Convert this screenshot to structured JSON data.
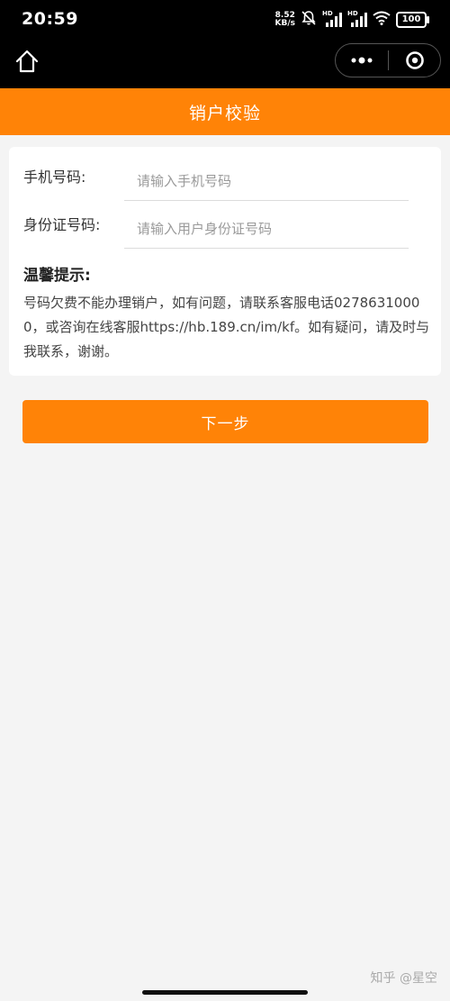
{
  "status_bar": {
    "time": "20:59",
    "net_speed_value": "8.52",
    "net_speed_unit": "KB/s",
    "signal1_tag": "HD",
    "signal2_tag": "HD",
    "battery": "100"
  },
  "header": {
    "title": "销户校验"
  },
  "form": {
    "phone": {
      "label": "手机号码:",
      "placeholder": "请输入手机号码",
      "value": ""
    },
    "id_card": {
      "label": "身份证号码:",
      "placeholder": "请输入用户身份证号码",
      "value": ""
    }
  },
  "tip": {
    "title": "温馨提示:",
    "text": "号码欠费不能办理销户，如有问题，请联系客服电话02786310000，或咨询在线客服https://hb.189.cn/im/kf。如有疑问，请及时与我联系，谢谢。"
  },
  "actions": {
    "next_label": "下一步"
  },
  "watermark": "知乎 @星空",
  "colors": {
    "accent": "#ff8307",
    "background": "#f4f4f4"
  }
}
